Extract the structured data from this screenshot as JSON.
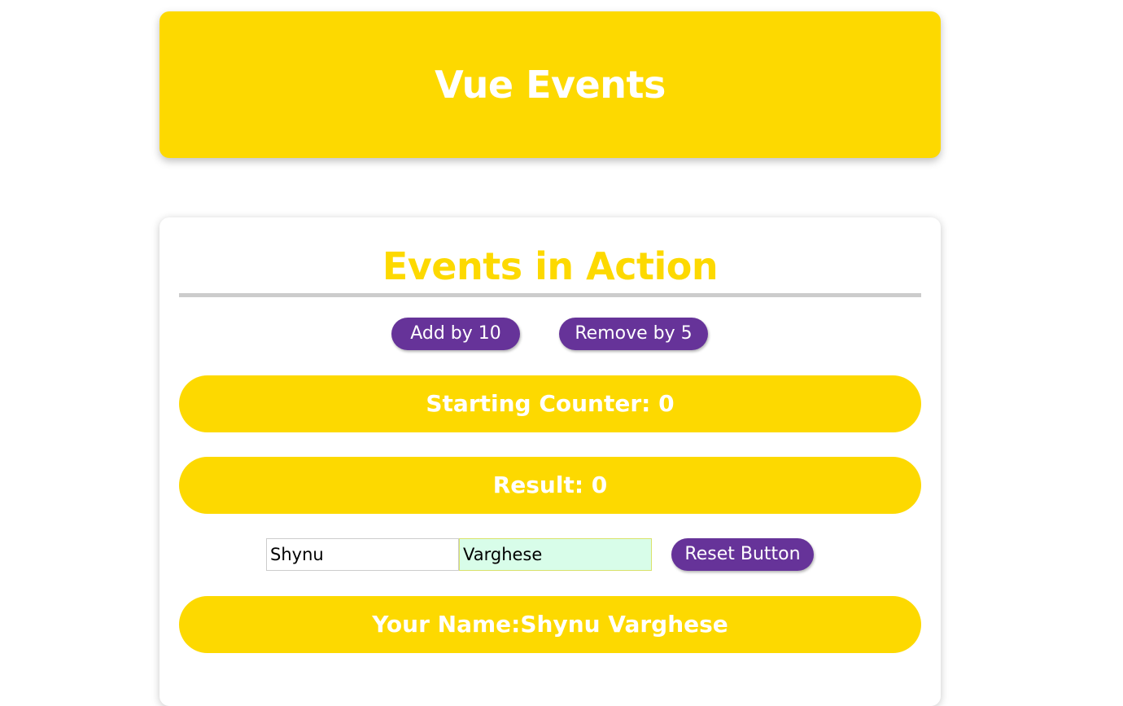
{
  "header": {
    "title": "Vue Events"
  },
  "card": {
    "title": "Events in Action",
    "add_button_label": "Add by 10",
    "remove_button_label": "Remove by 5",
    "starting_counter": "Starting Counter: 0",
    "result": "Result: 0",
    "first_name_value": "Shynu",
    "last_name_value": "Varghese",
    "reset_button_label": "Reset Button",
    "full_name": "Your Name:Shynu Varghese"
  },
  "colors": {
    "accent_yellow": "#fdd900",
    "button_purple": "#663399",
    "focused_input_bg": "#d8fde9"
  }
}
